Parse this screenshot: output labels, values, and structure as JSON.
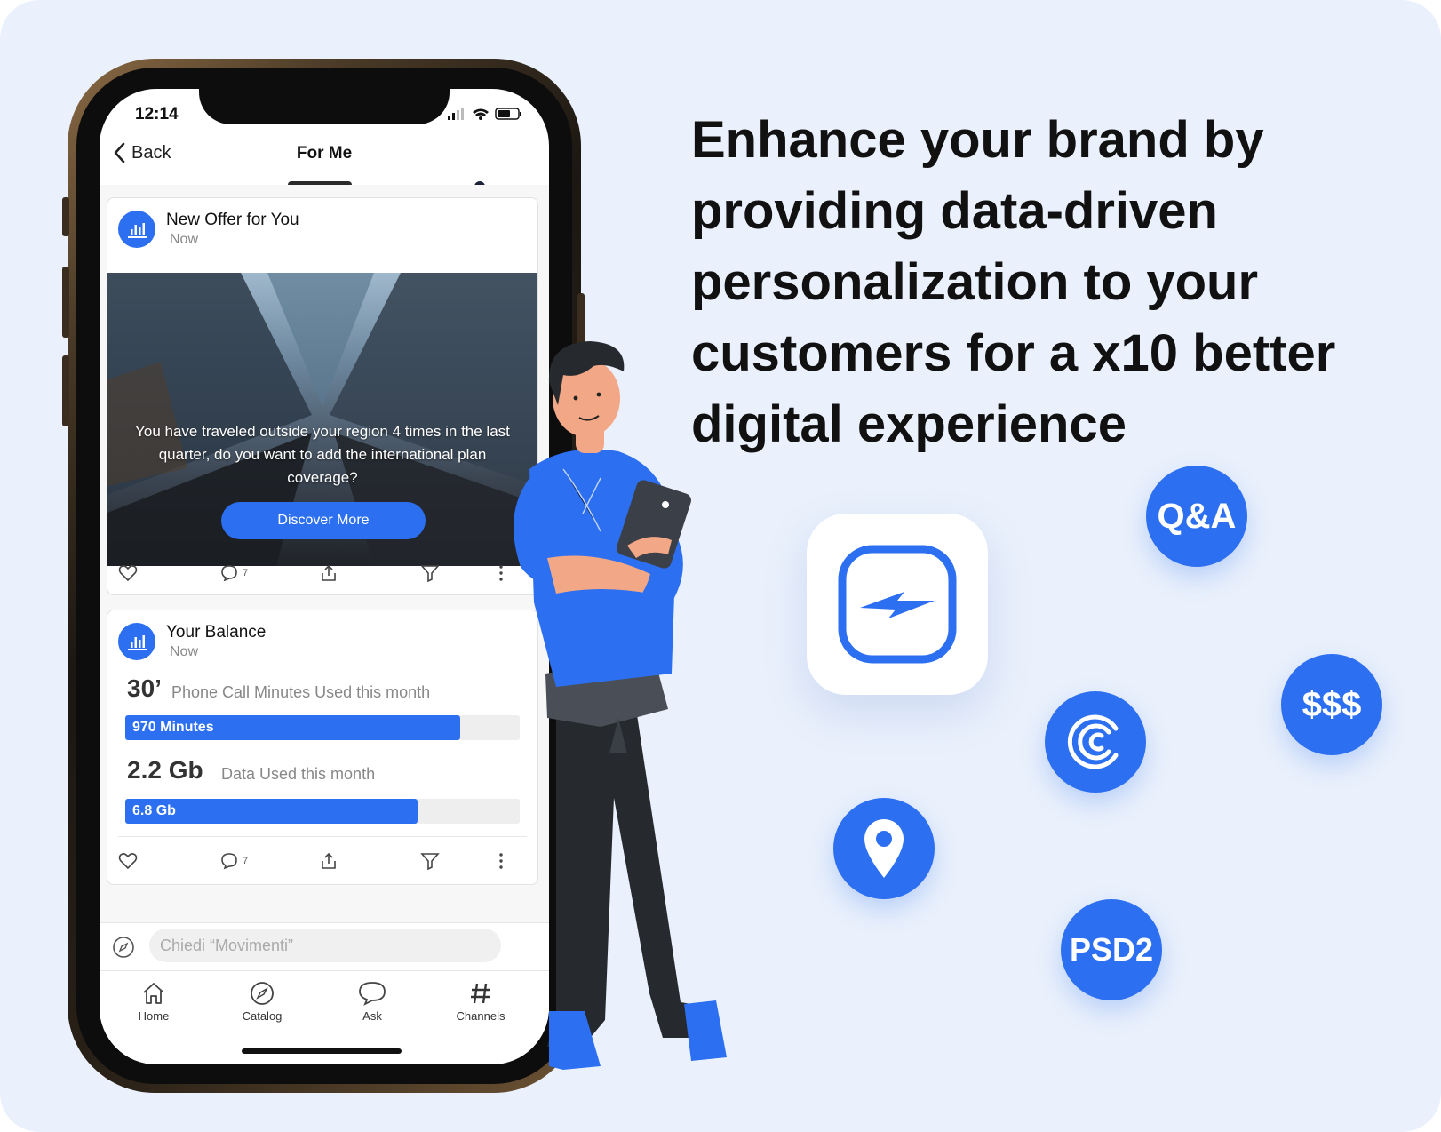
{
  "headline": "Enhance your brand by providing data-driven personalization to your customers for a x10 better digital experience",
  "status": {
    "time": "12:14"
  },
  "nav": {
    "back_label": "Back",
    "title": "For Me"
  },
  "offer_card": {
    "title": "New Offer for You",
    "time": "Now",
    "message": "You have traveled outside your region 4 times in the last quarter, do you want to add the international plan coverage?",
    "cta_label": "Discover More",
    "comments_count": "7"
  },
  "balance_card": {
    "title": "Your Balance",
    "time": "Now",
    "minutes_value": "30’",
    "minutes_label": "Phone Call Minutes Used this month",
    "minutes_bar_label": "970 Minutes",
    "minutes_fraction": 0.85,
    "data_value": "2.2 Gb",
    "data_label": "Data Used this month",
    "data_bar_label": "6.8 Gb",
    "data_fraction": 0.74,
    "comments_count": "7"
  },
  "chat": {
    "placeholder": "Chiedi “Movimenti”"
  },
  "tabs": [
    {
      "label": "Home",
      "icon": "home-icon"
    },
    {
      "label": "Catalog",
      "icon": "compass-icon"
    },
    {
      "label": "Ask",
      "icon": "chat-bubble-icon"
    },
    {
      "label": "Channels",
      "icon": "hash-icon"
    }
  ],
  "bubbles": {
    "qa": "Q&A",
    "money": "$$$",
    "psd2": "PSD2"
  },
  "colors": {
    "accent": "#2c6ff0",
    "background": "#eaf1fc"
  }
}
